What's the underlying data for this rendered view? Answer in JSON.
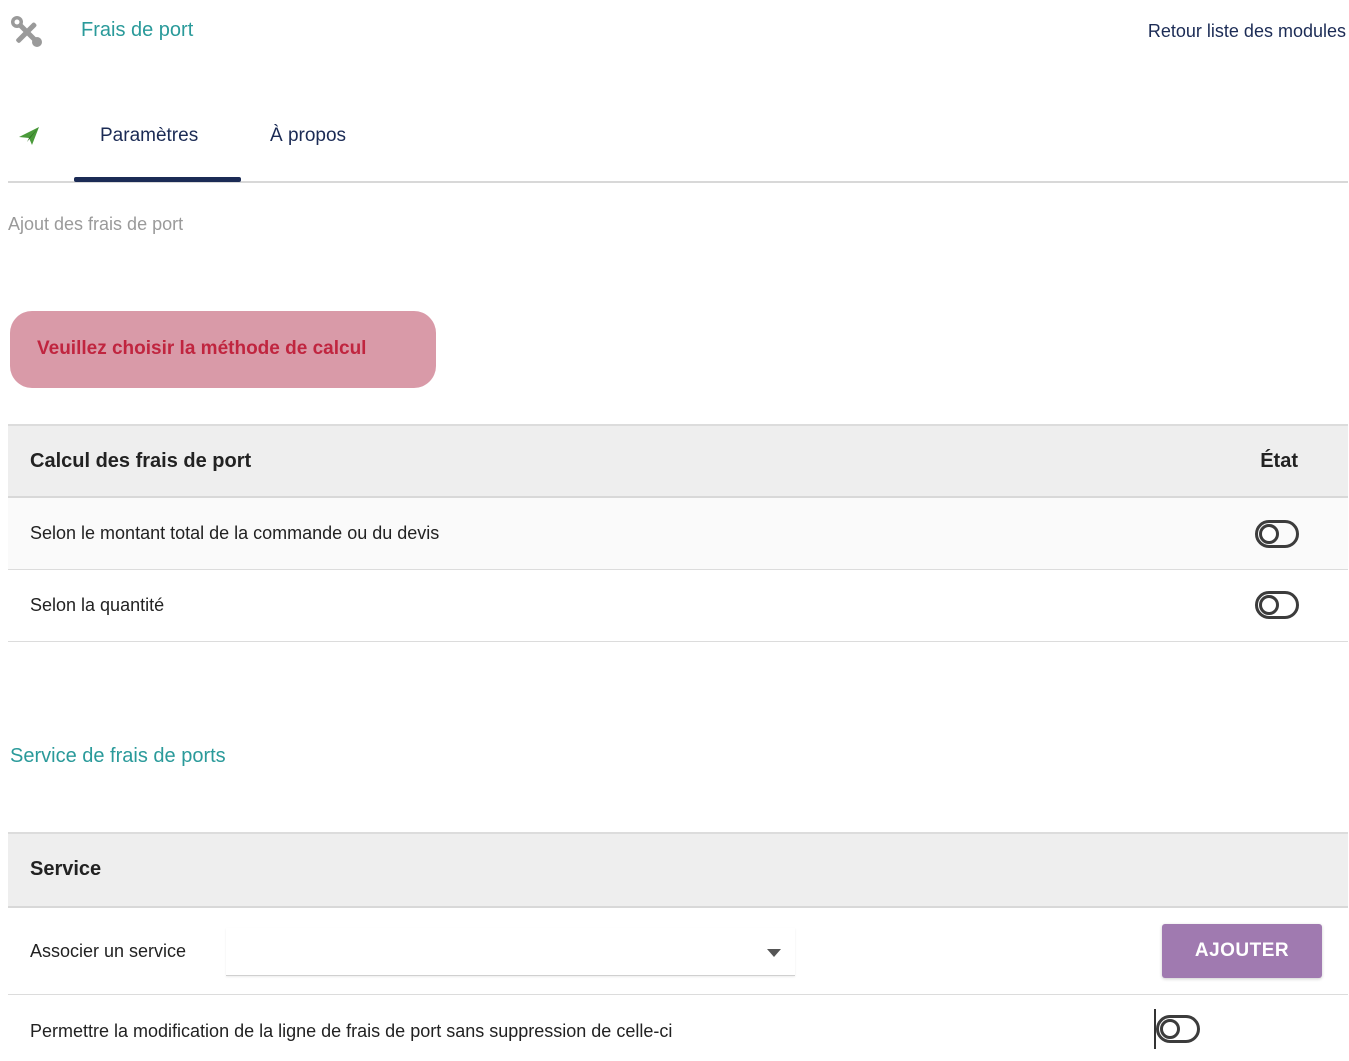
{
  "header": {
    "module_title": "Frais de port",
    "back_link": "Retour liste des modules"
  },
  "tabs": [
    {
      "label": "Paramètres",
      "active": true
    },
    {
      "label": "À propos",
      "active": false
    }
  ],
  "section_label": "Ajout des frais de port",
  "alert": {
    "text": "Veuillez choisir la méthode de calcul"
  },
  "calc_table": {
    "header": "Calcul des frais de port",
    "state_header": "État",
    "rows": [
      {
        "label": "Selon le montant total de la commande ou du devis",
        "enabled": false
      },
      {
        "label": "Selon la quantité",
        "enabled": false
      }
    ]
  },
  "service_section_title": "Service de frais de ports",
  "service_table": {
    "header": "Service",
    "associate_label": "Associer un service",
    "select_value": "",
    "add_button": "AJOUTER",
    "modify_label": "Permettre la modification de la ligne de frais de port sans suppression de celle-ci",
    "modify_enabled": false
  },
  "colors": {
    "accent_teal": "#2a9a9a",
    "navy": "#1b2b55",
    "alert_bg": "#d99aa8",
    "alert_text": "#c0253f",
    "button_purple": "#a07ab0",
    "plane_green": "#4a9a3a"
  },
  "icons": {
    "header": "tools-icon",
    "tab": "paper-plane-icon"
  }
}
